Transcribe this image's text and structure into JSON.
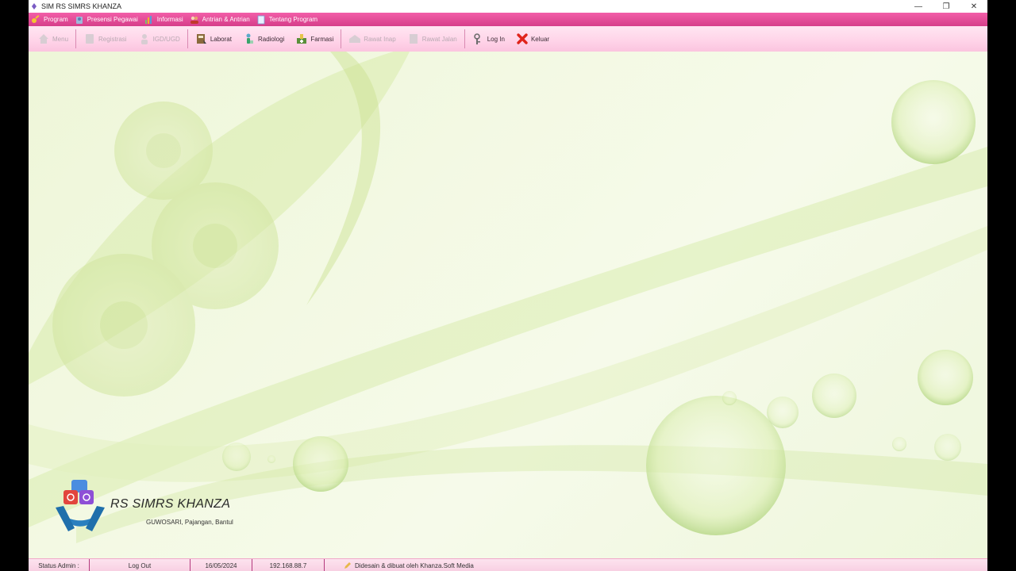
{
  "window": {
    "title": "SIM RS SIMRS KHANZA",
    "minimize_label": "—",
    "restore_label": "❐",
    "close_label": "✕"
  },
  "menu": [
    {
      "label": "Program",
      "icon": "key-icon"
    },
    {
      "label": "Presensi Pegawai",
      "icon": "employee-icon"
    },
    {
      "label": "Informasi",
      "icon": "info-chart-icon"
    },
    {
      "label": "Antrian & Antrian",
      "icon": "users-icon"
    },
    {
      "label": "Tentang Program",
      "icon": "document-icon"
    }
  ],
  "toolbar": [
    {
      "label": "Menu",
      "icon": "home-icon",
      "enabled": false
    },
    {
      "label": "Registrasi",
      "icon": "registration-icon",
      "enabled": false
    },
    {
      "label": "IGD/UGD",
      "icon": "emergency-icon",
      "enabled": false
    },
    {
      "label": "Laborat",
      "icon": "lab-book-icon",
      "enabled": true
    },
    {
      "label": "Radiologi",
      "icon": "radiology-icon",
      "enabled": true
    },
    {
      "label": "Farmasi",
      "icon": "pharmacy-icon",
      "enabled": true
    },
    {
      "label": "Rawat Inap",
      "icon": "inpatient-icon",
      "enabled": false
    },
    {
      "label": "Rawat Jalan",
      "icon": "outpatient-icon",
      "enabled": false
    },
    {
      "label": "Log In",
      "icon": "login-icon",
      "enabled": true
    },
    {
      "label": "Keluar",
      "icon": "exit-icon",
      "enabled": true
    }
  ],
  "brand": {
    "name": "RS SIMRS KHANZA",
    "address": "GUWOSARI, Pajangan, Bantul"
  },
  "status": {
    "user": "Status Admin :",
    "action": "Log Out",
    "date": "16/05/2024",
    "ip": "192.168.88.7",
    "credit": "Didesain & dibuat oleh Khanza.Soft Media"
  },
  "colors": {
    "menubar": "#e24c98",
    "toolbar": "#ffd6ea",
    "desktop": "#f1f8df",
    "separator": "#b43a7e"
  }
}
